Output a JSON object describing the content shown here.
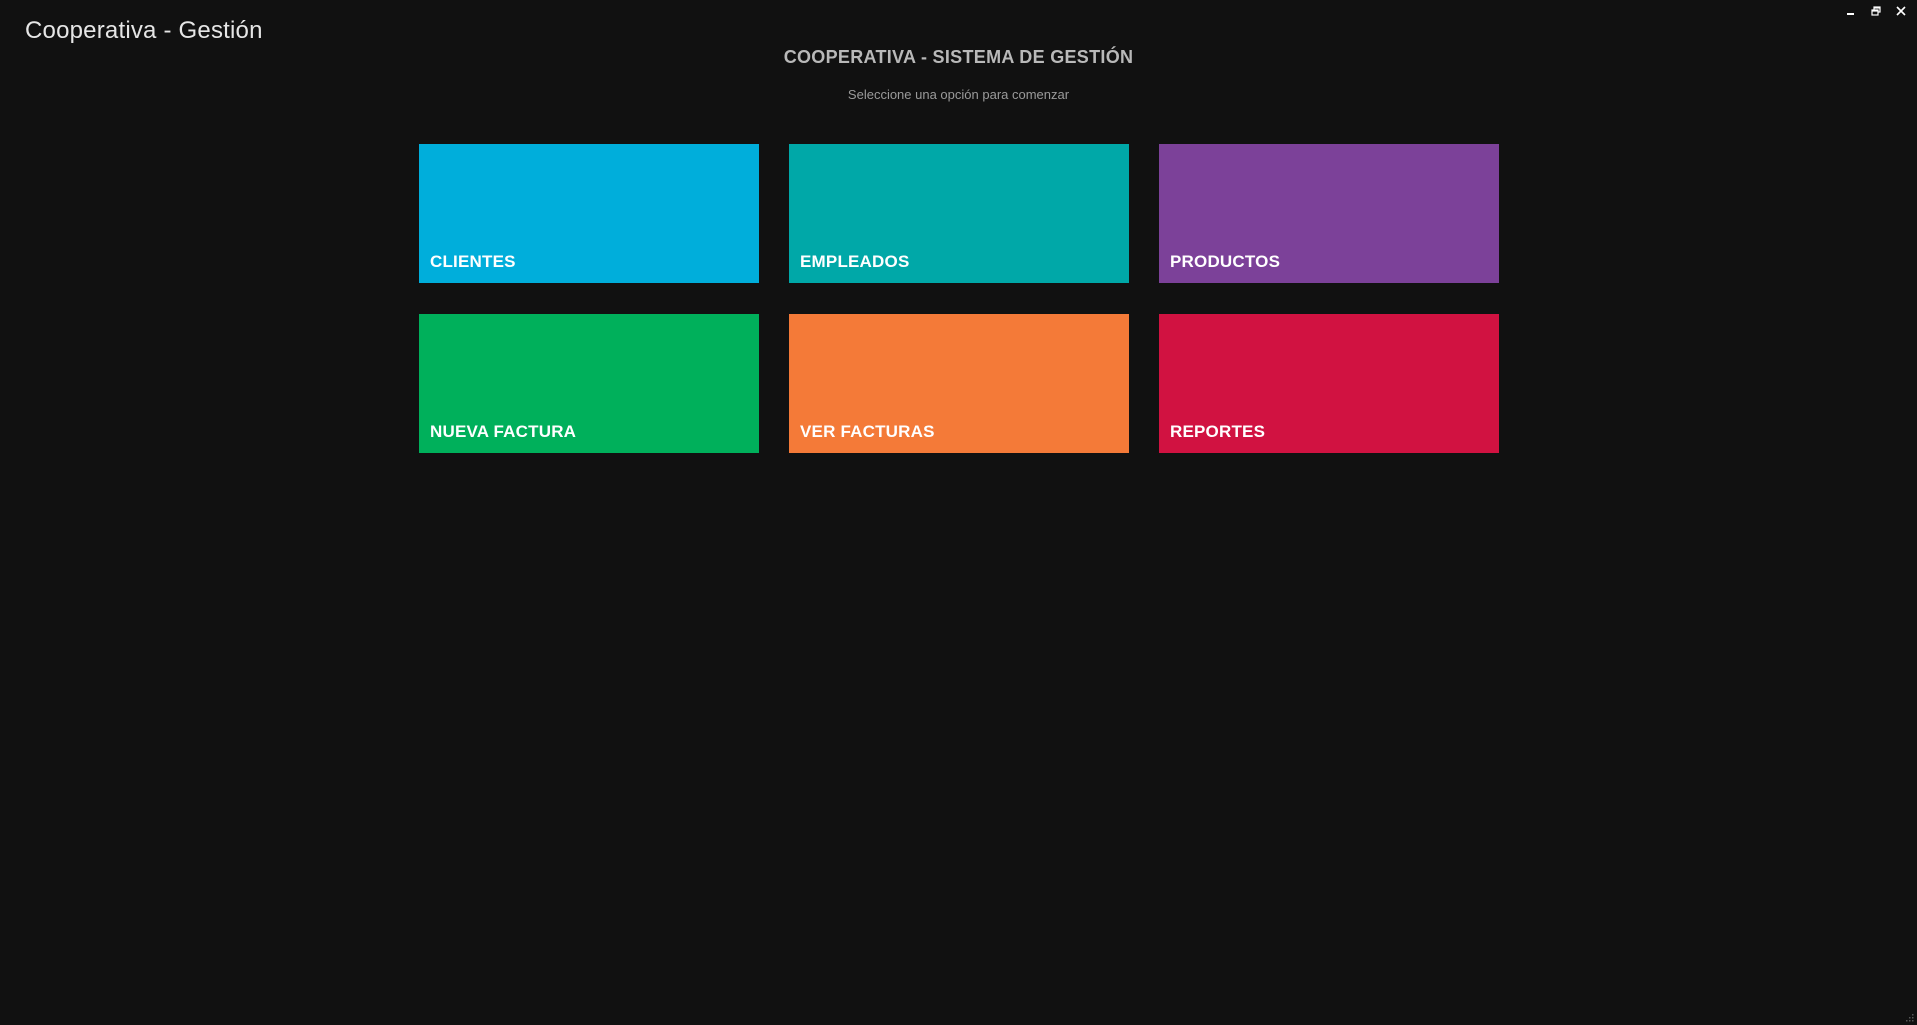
{
  "window": {
    "title": "Cooperativa - Gestión",
    "controls": [
      {
        "name": "minimize-icon"
      },
      {
        "name": "restore-icon"
      },
      {
        "name": "close-icon"
      }
    ]
  },
  "header": {
    "title": "COOPERATIVA - SISTEMA DE GESTIÓN",
    "subtitle": "Seleccione una opción para comenzar"
  },
  "tiles": [
    {
      "label": "CLIENTES",
      "color": "#00AEDB"
    },
    {
      "label": "EMPLEADOS",
      "color": "#00A8A8"
    },
    {
      "label": "PRODUCTOS",
      "color": "#7C4199"
    },
    {
      "label": "NUEVA FACTURA",
      "color": "#00B05B"
    },
    {
      "label": "VER FACTURAS",
      "color": "#F47A38"
    },
    {
      "label": "REPORTES",
      "color": "#D11241"
    }
  ],
  "colors": {
    "background": "#111111",
    "title_text": "#E6E6E6",
    "header_text": "#B9B9B9"
  }
}
